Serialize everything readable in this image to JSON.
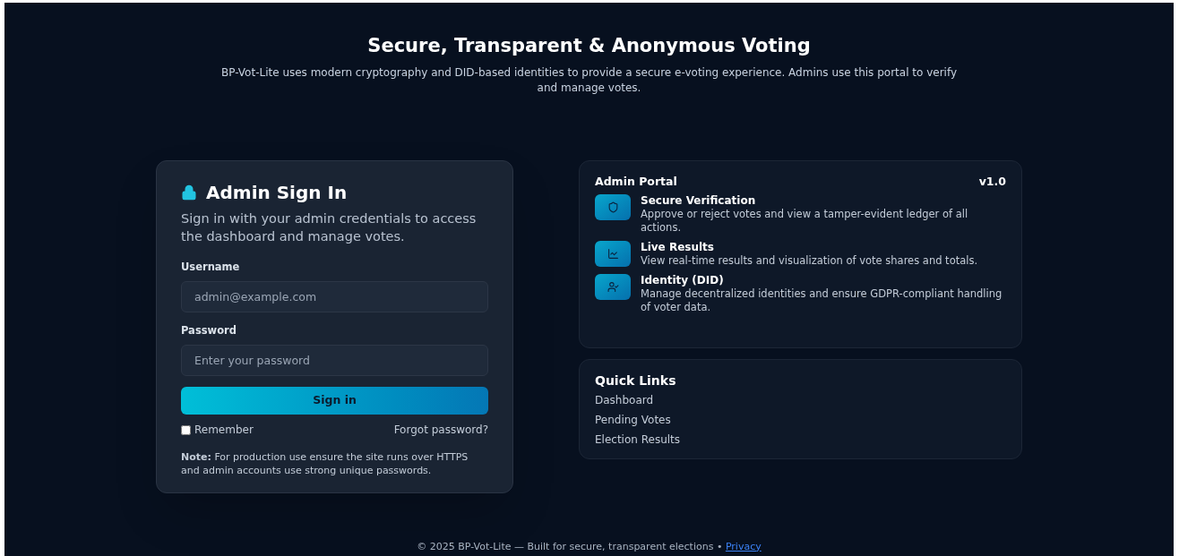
{
  "hero": {
    "title": "Secure, Transparent & Anonymous Voting",
    "subtitle": "BP-Vot-Lite uses modern cryptography and DID-based identities to provide a secure e-voting experience. Admins use this portal to verify and manage votes."
  },
  "signin": {
    "title": "Admin Sign In",
    "description": "Sign in with your admin credentials to access the dashboard and manage votes.",
    "fields": [
      {
        "label": "Username",
        "placeholder": "admin@example.com"
      },
      {
        "label": "Password",
        "placeholder": "Enter your password"
      }
    ],
    "submit": "Sign in",
    "remember": {
      "label": "Remember",
      "checked": false
    },
    "forgot": "Forgot password?",
    "note": "**Note:** For production use ensure the site runs over HTTPS and admin accounts use strong unique passwords."
  },
  "portal": {
    "title": "Admin Portal",
    "version": "v1.0",
    "features": [
      {
        "kind": "shield",
        "title": "Secure Verification",
        "text": "Approve or reject votes and view a tamper-evident ledger of all actions."
      },
      {
        "kind": "chart",
        "title": "Live Results",
        "text": "View real-time results and visualization of vote shares and totals."
      },
      {
        "kind": "identity",
        "title": "Identity (DID)",
        "text": "Manage decentralized identities and ensure GDPR-compliant handling of voter data."
      }
    ]
  },
  "quick_links": {
    "title": "Quick Links",
    "items": [
      "Dashboard",
      "Pending Votes",
      "Election Results"
    ]
  },
  "footer": {
    "text": "© 2025 BP-Vot-Lite — Built for secure, transparent elections •",
    "link": "Privacy"
  }
}
